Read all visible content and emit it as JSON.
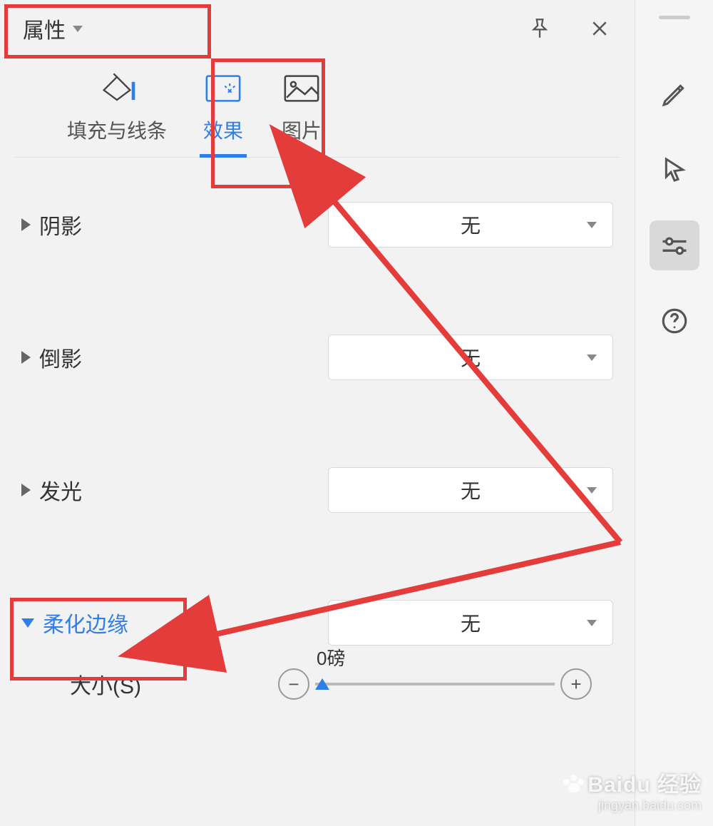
{
  "header": {
    "title": "属性"
  },
  "tabs": {
    "fill": "填充与线条",
    "effects": "效果",
    "picture": "图片"
  },
  "effects": {
    "shadow": {
      "label": "阴影",
      "value": "无"
    },
    "reflection": {
      "label": "倒影",
      "value": "无"
    },
    "glow": {
      "label": "发光",
      "value": "无"
    },
    "softedge": {
      "label": "柔化边缘",
      "value": "无"
    }
  },
  "size": {
    "label": "大小(S)",
    "value": "0磅"
  },
  "watermark": {
    "main": "Baidu 经验",
    "sub": "jingyan.baidu.com"
  }
}
